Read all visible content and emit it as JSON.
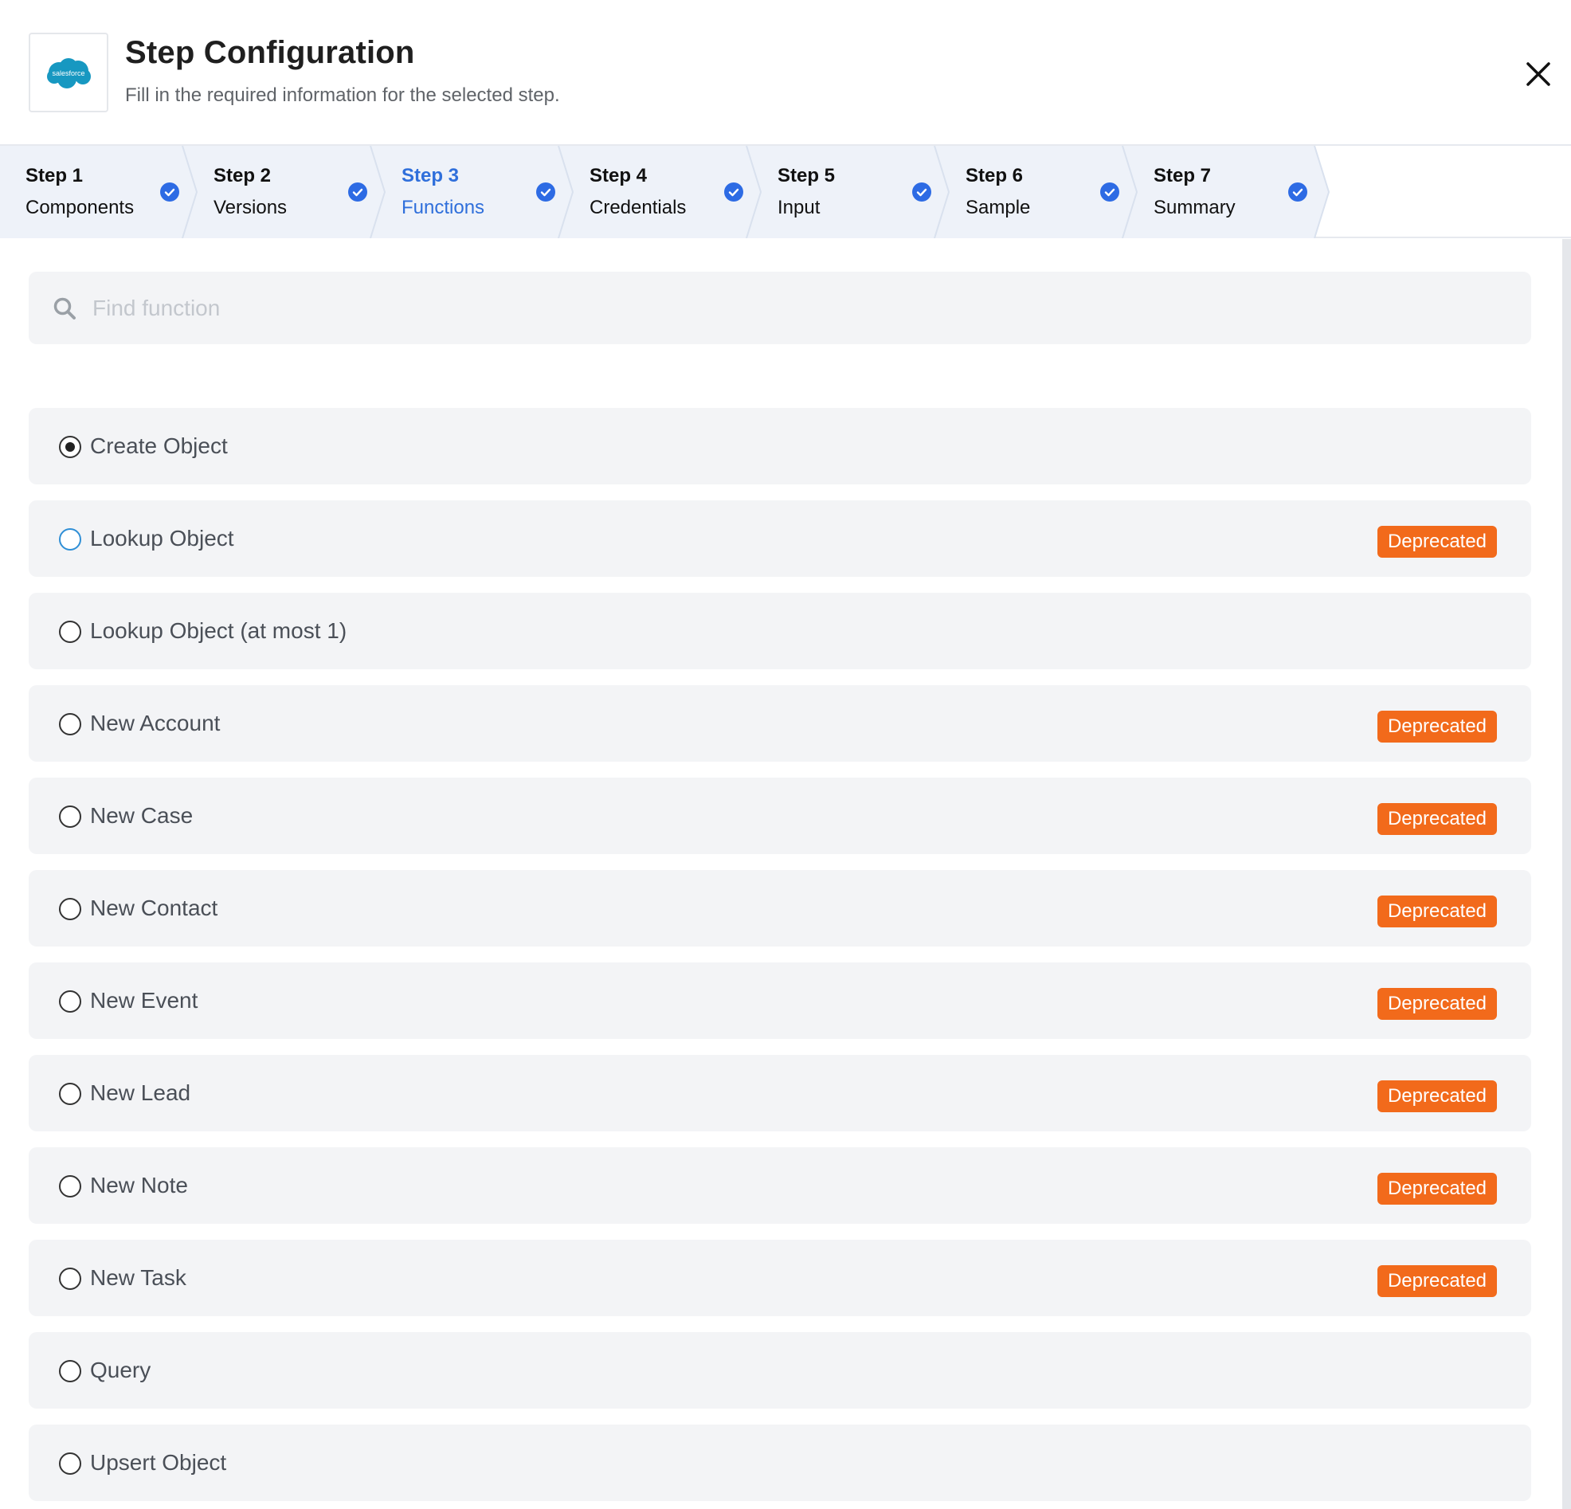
{
  "header": {
    "logo_text": "salesforce",
    "title": "Step Configuration",
    "subtitle": "Fill in the required information for the selected step."
  },
  "stepper": {
    "steps": [
      {
        "num": "Step 1",
        "label": "Components",
        "completed": true,
        "active": false
      },
      {
        "num": "Step 2",
        "label": "Versions",
        "completed": true,
        "active": false
      },
      {
        "num": "Step 3",
        "label": "Functions",
        "completed": true,
        "active": true
      },
      {
        "num": "Step 4",
        "label": "Credentials",
        "completed": true,
        "active": false
      },
      {
        "num": "Step 5",
        "label": "Input",
        "completed": true,
        "active": false
      },
      {
        "num": "Step 6",
        "label": "Sample",
        "completed": true,
        "active": false
      },
      {
        "num": "Step 7",
        "label": "Summary",
        "completed": true,
        "active": false
      }
    ]
  },
  "search": {
    "placeholder": "Find function",
    "value": ""
  },
  "functions": {
    "deprecated_label": "Deprecated",
    "items": [
      {
        "label": "Create Object",
        "selected": true,
        "deprecated": false
      },
      {
        "label": "Lookup Object",
        "selected": false,
        "deprecated": true
      },
      {
        "label": "Lookup Object (at most 1)",
        "selected": false,
        "deprecated": false
      },
      {
        "label": "New Account",
        "selected": false,
        "deprecated": true
      },
      {
        "label": "New Case",
        "selected": false,
        "deprecated": true
      },
      {
        "label": "New Contact",
        "selected": false,
        "deprecated": true
      },
      {
        "label": "New Event",
        "selected": false,
        "deprecated": true
      },
      {
        "label": "New Lead",
        "selected": false,
        "deprecated": true
      },
      {
        "label": "New Note",
        "selected": false,
        "deprecated": true
      },
      {
        "label": "New Task",
        "selected": false,
        "deprecated": true
      },
      {
        "label": "Query",
        "selected": false,
        "deprecated": false
      },
      {
        "label": "Upsert Object",
        "selected": false,
        "deprecated": false
      }
    ]
  },
  "colors": {
    "accent_blue": "#2f6fdb",
    "check_blue": "#2d6be4",
    "deprecated_orange": "#f26a1b",
    "stepper_bg": "#eef2f9",
    "row_bg": "#f3f4f6",
    "salesforce_blue": "#1798c1"
  }
}
